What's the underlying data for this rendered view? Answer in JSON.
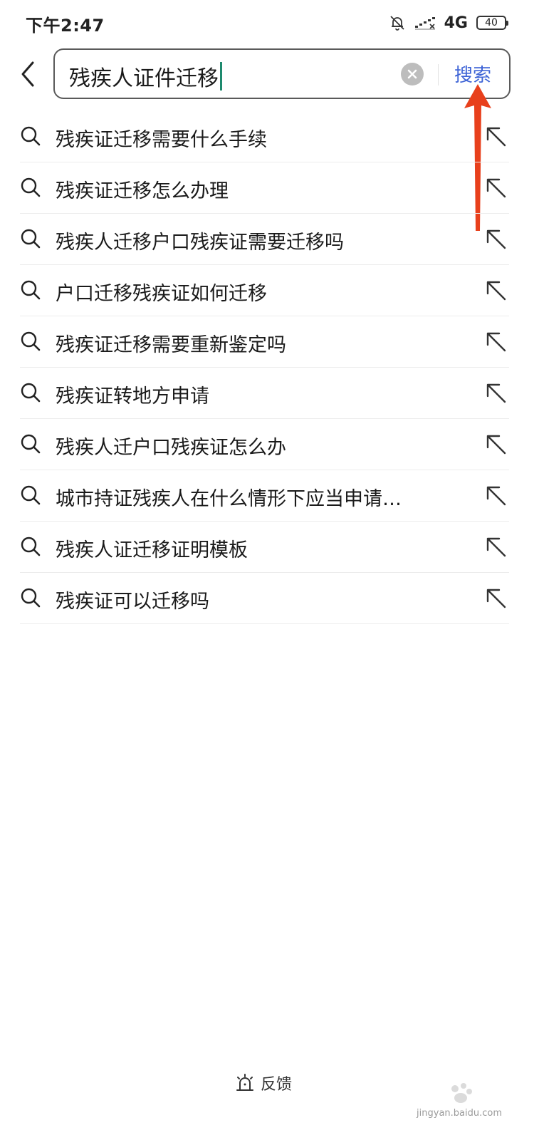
{
  "status_bar": {
    "time": "下午2:47",
    "network": "4G",
    "battery": "40"
  },
  "search": {
    "query": "残疾人证件迁移",
    "button_label": "搜索",
    "accent_color": "#3e64d6",
    "caret_color": "#1e8a6e"
  },
  "suggestions": [
    {
      "text": "残疾证迁移需要什么手续"
    },
    {
      "text": "残疾证迁移怎么办理"
    },
    {
      "text": "残疾人迁移户口残疾证需要迁移吗"
    },
    {
      "text": "户口迁移残疾证如何迁移"
    },
    {
      "text": "残疾证迁移需要重新鉴定吗"
    },
    {
      "text": "残疾证转地方申请"
    },
    {
      "text": "残疾人迁户口残疾证怎么办"
    },
    {
      "text": "城市持证残疾人在什么情形下应当申请…"
    },
    {
      "text": "残疾人证迁移证明模板"
    },
    {
      "text": "残疾证可以迁移吗"
    }
  ],
  "footer": {
    "feedback_label": "反馈"
  },
  "watermark": {
    "text": "jingyan.baidu.com"
  },
  "annotation": {
    "arrow_color": "#e8401c"
  }
}
